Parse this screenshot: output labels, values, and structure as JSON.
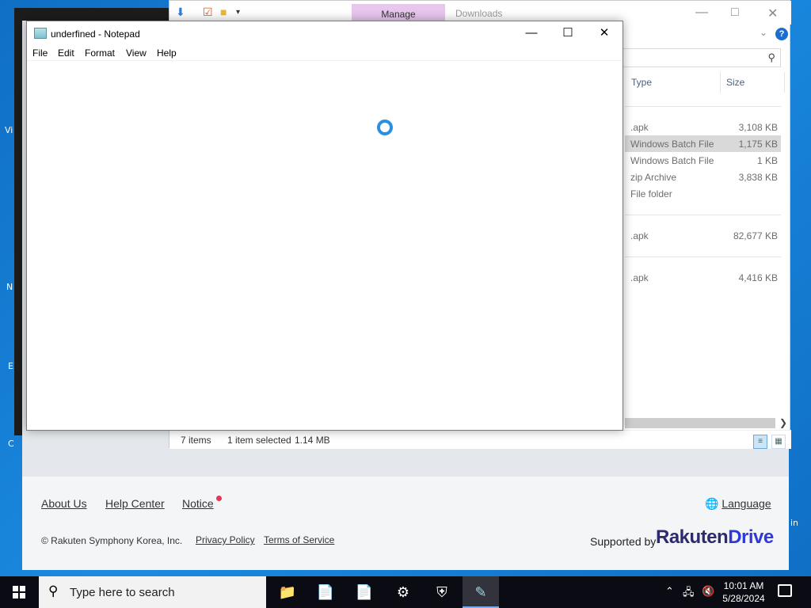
{
  "desktop": {
    "fragments": [
      "Vi",
      "N",
      "E",
      "C",
      "in"
    ]
  },
  "website": {
    "footer": {
      "about_us": "About Us",
      "help_center": "Help Center",
      "notice": "Notice",
      "language": "Language",
      "copyright": "© Rakuten Symphony Korea, Inc.",
      "privacy_policy": "Privacy Policy",
      "terms_of_service": "Terms of Service",
      "supported_by": "Supported by",
      "brand_part1": "Rakuten",
      "brand_part2": "Drive"
    },
    "notice_dot_color": "#e8335a"
  },
  "explorer": {
    "ribbon_tab_manage": "Manage",
    "title_downloads": "Downloads",
    "columns": {
      "type": "Type",
      "size": "Size"
    },
    "files": [
      {
        "type": ".apk",
        "size": "3,108 KB",
        "selected": false
      },
      {
        "type": "Windows Batch File",
        "size": "1,175 KB",
        "selected": true
      },
      {
        "type": "Windows Batch File",
        "size": "1 KB",
        "selected": false
      },
      {
        "type": "zip Archive",
        "size": "3,838 KB",
        "selected": false
      },
      {
        "type": "File folder",
        "size": "",
        "selected": false
      },
      {
        "type": ".apk",
        "size": "82,677 KB",
        "selected": false
      },
      {
        "type": ".apk",
        "size": "4,416 KB",
        "selected": false
      }
    ],
    "status": {
      "items": "7 items",
      "selected": "1 item selected",
      "size": "1.14 MB"
    },
    "help_label": "?",
    "manage_color": "#e8c6ef"
  },
  "notepad": {
    "title": "underfined - Notepad",
    "menu": [
      "File",
      "Edit",
      "Format",
      "View",
      "Help"
    ],
    "editor_content": "",
    "spinner_color": "#2b8fe0"
  },
  "taskbar": {
    "search_placeholder": "Type here to search",
    "apps": [
      "file-explorer-icon",
      "document-icon",
      "document-icon",
      "settings-gear-icon",
      "security-shield-icon",
      "notepad-icon"
    ],
    "clock_time": "10:01 AM",
    "clock_date": "5/28/2024"
  }
}
